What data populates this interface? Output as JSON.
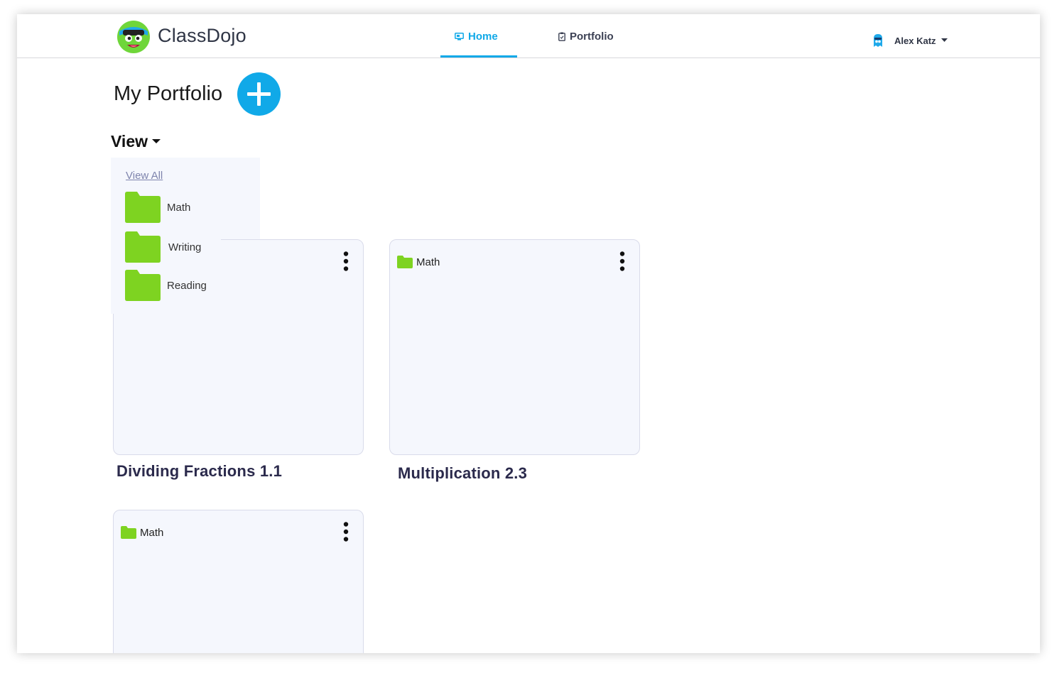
{
  "app": {
    "brand": "ClassDojo"
  },
  "nav": {
    "tabs": [
      {
        "label": "Home",
        "icon": "home-screen-icon",
        "active": true
      },
      {
        "label": "Portfolio",
        "icon": "clipboard-icon",
        "active": false
      }
    ],
    "user": {
      "name": "Alex Katz",
      "icon": "monster-avatar-icon"
    }
  },
  "page": {
    "title": "My Portfolio",
    "add_icon": "plus-icon",
    "view_label": "View"
  },
  "view_dropdown": {
    "view_all": "View All",
    "folders": [
      {
        "label": "Math",
        "icon": "folder-icon"
      },
      {
        "label": "Writing",
        "icon": "folder-icon"
      },
      {
        "label": "Reading",
        "icon": "folder-icon"
      }
    ]
  },
  "cards": [
    {
      "tag": "",
      "title": "Dividing Fractions 1.1"
    },
    {
      "tag": "Math",
      "title": "Multiplication 2.3"
    },
    {
      "tag": "Math",
      "title": ""
    }
  ],
  "colors": {
    "accent": "#10a9e8",
    "folder_green": "#7ed321",
    "card_bg": "#f5f7fd",
    "card_title": "#2b2a4c"
  }
}
